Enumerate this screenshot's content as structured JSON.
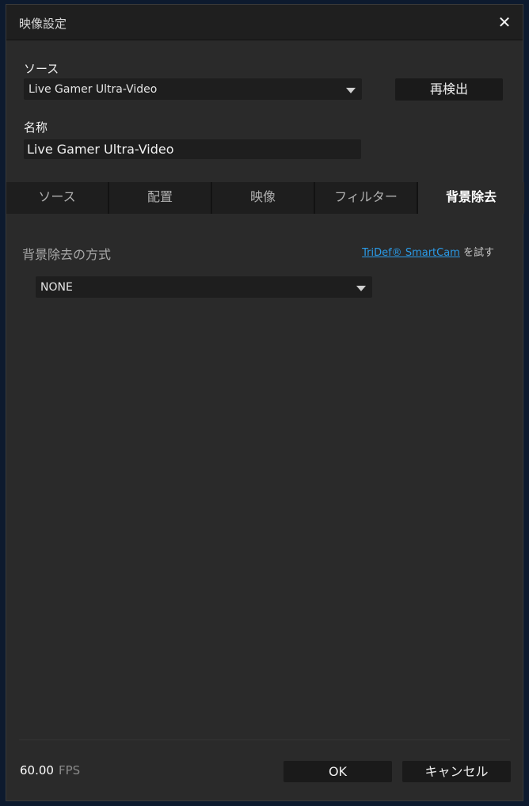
{
  "window": {
    "title": "映像設定"
  },
  "source": {
    "label": "ソース",
    "selected": "Live Gamer Ultra-Video",
    "redetect_label": "再検出"
  },
  "name_field": {
    "label": "名称",
    "value": "Live Gamer Ultra-Video"
  },
  "tabs": [
    {
      "label": "ソース",
      "active": false
    },
    {
      "label": "配置",
      "active": false
    },
    {
      "label": "映像",
      "active": false
    },
    {
      "label": "フィルター",
      "active": false
    },
    {
      "label": "背景除去",
      "active": true
    }
  ],
  "background_removal": {
    "section_title": "背景除去の方式",
    "link_text": "TriDef® SmartCam",
    "link_suffix": " を試す",
    "method_selected": "NONE"
  },
  "footer": {
    "fps_value": "60.00",
    "fps_unit": "FPS",
    "ok_label": "OK",
    "cancel_label": "キャンセル"
  }
}
